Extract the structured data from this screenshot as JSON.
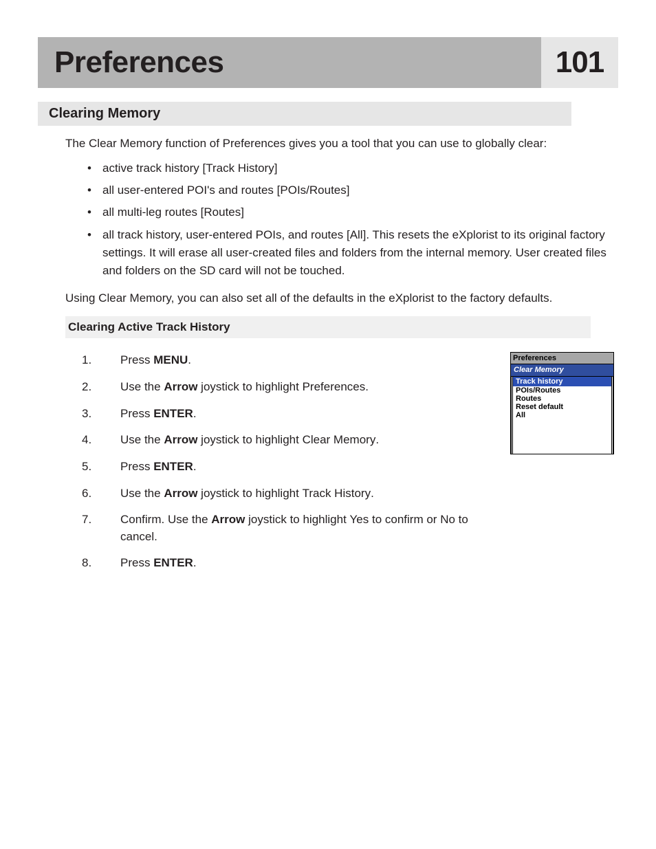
{
  "header": {
    "title": "Preferences",
    "page_number": "101"
  },
  "section_heading": "Clearing Memory",
  "intro": "The Clear Memory function of Preferences gives you a tool that you can use to globally clear:",
  "bullets": [
    {
      "pre": "active track history [",
      "label": "Track History",
      "post": "]"
    },
    {
      "pre": "all user-entered POI's and routes [",
      "label": "POIs/Routes",
      "post": "]"
    },
    {
      "pre": "all multi-leg routes [",
      "label": "Routes",
      "post": "]"
    },
    {
      "pre": "all track history, user-entered POIs, and routes [",
      "label": "All",
      "post": "].  This resets the eXplorist to its original factory settings.  It will erase all user-created files and folders from the internal memory.  User created files and folders on the SD card will not be touched."
    }
  ],
  "after_bullets": "Using Clear Memory, you can also set all of the defaults in the eXplorist to the factory defaults.",
  "sub_heading": "Clearing Active Track History",
  "steps": {
    "s1a": "Press ",
    "s1b": "MENU",
    "s1c": ".",
    "s2a": "Use the ",
    "s2b": "Arrow",
    "s2c": " joystick to highlight ",
    "s2d": "Preferences",
    "s2e": ".",
    "s3a": "Press ",
    "s3b": "ENTER",
    "s3c": ".",
    "s4a": "Use the ",
    "s4b": "Arrow",
    "s4c": " joystick to highlight ",
    "s4d": "Clear Memory",
    "s4e": ".",
    "s5a": "Press ",
    "s5b": "ENTER",
    "s5c": ".",
    "s6a": "Use the ",
    "s6b": "Arrow",
    "s6c": " joystick to highlight ",
    "s6d": "Track History",
    "s6e": ".",
    "s7a": "Confirm.  Use the ",
    "s7b": "Arrow",
    "s7c": " joystick to highlight ",
    "s7d": "Yes",
    "s7e": " to confirm or ",
    "s7f": "No",
    "s7g": " to cancel.",
    "s8a": "Press ",
    "s8b": "ENTER",
    "s8c": "."
  },
  "device": {
    "title": "Preferences",
    "subbar": "Clear Memory",
    "selected": "Track history",
    "items": [
      "POIs/Routes",
      "Routes",
      "Reset default",
      "All"
    ]
  }
}
